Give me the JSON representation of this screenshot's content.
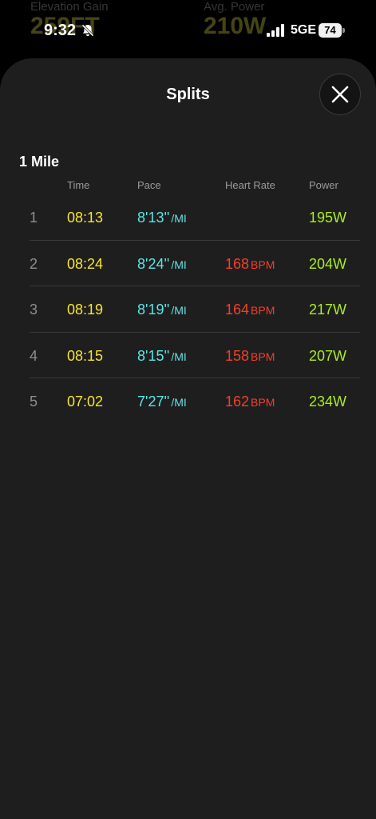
{
  "status_bar": {
    "time": "9:32",
    "network": "5GE",
    "battery": "74"
  },
  "background": {
    "stat_left": {
      "label": "Elevation Gain",
      "value": "259FT"
    },
    "stat_right": {
      "label": "Avg. Power",
      "value": "210W"
    }
  },
  "sheet": {
    "title": "Splits",
    "section_title": "1 Mile",
    "columns": [
      "Time",
      "Pace",
      "Heart Rate",
      "Power"
    ],
    "colors": {
      "time": "#f6e531",
      "pace": "#5ce6e3",
      "heart_rate": "#f2402c",
      "power": "#a9ee1c"
    },
    "rows": [
      {
        "num": "1",
        "time": "08:13",
        "pace": "8'13''",
        "pace_unit": "/MI",
        "hr": "",
        "hr_unit": "",
        "power": "195W"
      },
      {
        "num": "2",
        "time": "08:24",
        "pace": "8'24''",
        "pace_unit": "/MI",
        "hr": "168",
        "hr_unit": "BPM",
        "power": "204W"
      },
      {
        "num": "3",
        "time": "08:19",
        "pace": "8'19''",
        "pace_unit": "/MI",
        "hr": "164",
        "hr_unit": "BPM",
        "power": "217W"
      },
      {
        "num": "4",
        "time": "08:15",
        "pace": "8'15''",
        "pace_unit": "/MI",
        "hr": "158",
        "hr_unit": "BPM",
        "power": "207W"
      },
      {
        "num": "5",
        "time": "07:02",
        "pace": "7'27''",
        "pace_unit": "/MI",
        "hr": "162",
        "hr_unit": "BPM",
        "power": "234W"
      }
    ]
  }
}
